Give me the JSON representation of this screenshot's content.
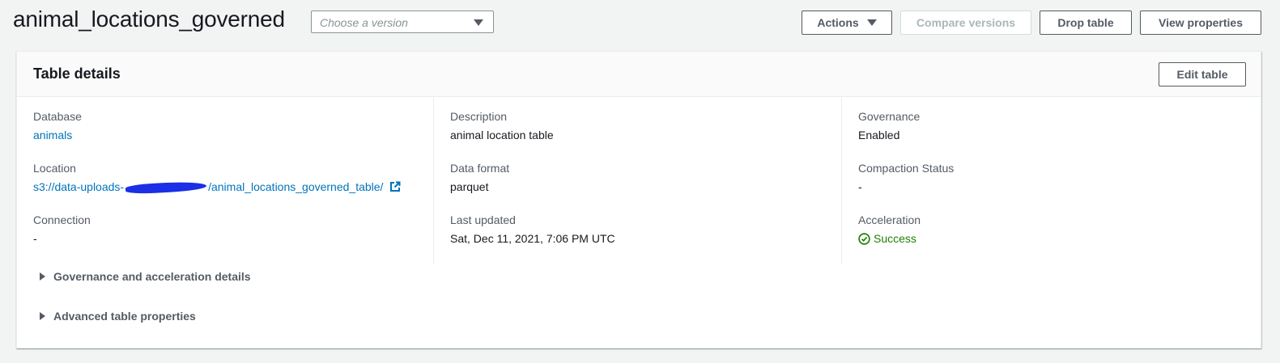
{
  "header": {
    "title": "animal_locations_governed",
    "version_select": {
      "placeholder": "Choose a version"
    },
    "buttons": {
      "actions": "Actions",
      "compare": "Compare versions",
      "drop": "Drop table",
      "view": "View properties"
    }
  },
  "table_details": {
    "title": "Table details",
    "edit_button": "Edit table",
    "fields": {
      "database": {
        "label": "Database",
        "value": "animals"
      },
      "location": {
        "label": "Location",
        "value_prefix": "s3://data-uploads-",
        "value_suffix": "/animal_locations_governed_table/"
      },
      "connection": {
        "label": "Connection",
        "value": "-"
      },
      "description": {
        "label": "Description",
        "value": "animal location table"
      },
      "data_format": {
        "label": "Data format",
        "value": "parquet"
      },
      "last_updated": {
        "label": "Last updated",
        "value": "Sat, Dec 11, 2021, 7:06 PM UTC"
      },
      "governance": {
        "label": "Governance",
        "value": "Enabled"
      },
      "compaction_status": {
        "label": "Compaction Status",
        "value": "-"
      },
      "acceleration": {
        "label": "Acceleration",
        "value": "Success"
      }
    },
    "expanders": {
      "governance": "Governance and acceleration details",
      "advanced": "Advanced table properties"
    }
  },
  "colors": {
    "link": "#0073bb",
    "success": "#1d8102",
    "text": "#16191f",
    "muted": "#545b64"
  },
  "icons": [
    "external-link-icon",
    "status-success-icon",
    "caret-down-icon",
    "caret-right-icon"
  ]
}
